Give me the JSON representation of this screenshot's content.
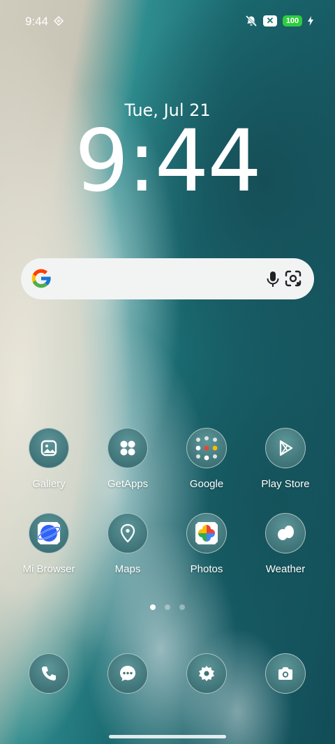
{
  "status_bar": {
    "time": "9:44",
    "battery": "100",
    "icons": [
      "vpn-diamond-icon",
      "bell-off-icon",
      "x-badge-icon",
      "battery-icon",
      "charging-bolt-icon"
    ]
  },
  "clock": {
    "date": "Tue, Jul 21",
    "time": "9:44"
  },
  "search": {
    "icons": [
      "google-logo-icon",
      "mic-icon",
      "lens-icon"
    ]
  },
  "apps": [
    {
      "label": "Gallery",
      "icon": "gallery-icon"
    },
    {
      "label": "GetApps",
      "icon": "getapps-icon"
    },
    {
      "label": "Google",
      "icon": "google-folder-icon"
    },
    {
      "label": "Play Store",
      "icon": "play-store-icon"
    },
    {
      "label": "Mi Browser",
      "icon": "mi-browser-icon"
    },
    {
      "label": "Maps",
      "icon": "maps-icon"
    },
    {
      "label": "Photos",
      "icon": "photos-icon"
    },
    {
      "label": "Weather",
      "icon": "weather-icon"
    }
  ],
  "pages": {
    "count": 3,
    "active": 1
  },
  "dock": [
    {
      "icon": "phone-icon"
    },
    {
      "icon": "messages-icon"
    },
    {
      "icon": "settings-icon"
    },
    {
      "icon": "camera-icon"
    }
  ],
  "colors": {
    "battery_green": "#2ecc40",
    "icon_bg": "#3f7478",
    "search_bg": "#f2f4f4"
  }
}
